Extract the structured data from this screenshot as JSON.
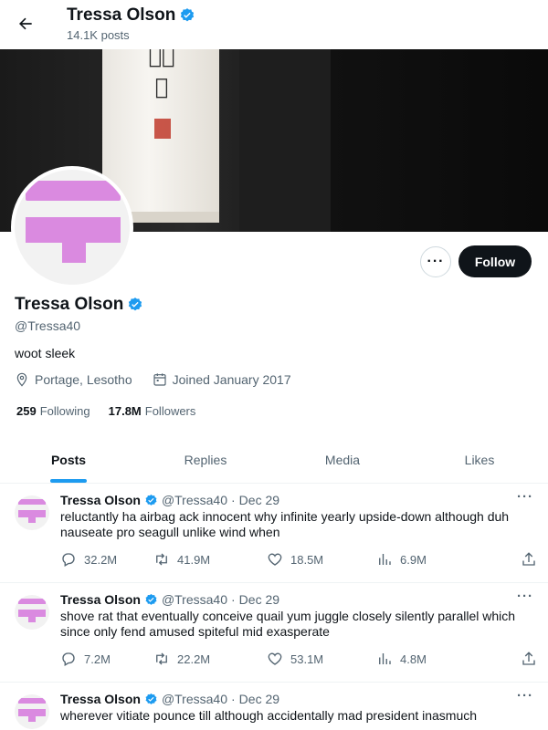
{
  "header": {
    "name": "Tressa Olson",
    "post_count": "14.1K posts"
  },
  "banner": {
    "lantern_text": "𠈜雲館"
  },
  "profile": {
    "name": "Tressa Olson",
    "handle": "@Tressa40",
    "bio": "woot sleek",
    "location": "Portage, Lesotho",
    "joined": "Joined January 2017",
    "following_count": "259",
    "following_label": "Following",
    "followers_count": "17.8M",
    "followers_label": "Followers",
    "follow_label": "Follow",
    "more_label": "···"
  },
  "tabs": [
    {
      "label": "Posts"
    },
    {
      "label": "Replies"
    },
    {
      "label": "Media"
    },
    {
      "label": "Likes"
    }
  ],
  "tweets": [
    {
      "name": "Tressa Olson",
      "handle": "@Tressa40",
      "dot": "·",
      "date": "Dec 29",
      "text": "reluctantly ha airbag ack innocent why infinite yearly upside-down although duh nauseate pro seagull unlike wind when",
      "replies": "32.2M",
      "retweets": "41.9M",
      "likes": "18.5M",
      "views": "6.9M"
    },
    {
      "name": "Tressa Olson",
      "handle": "@Tressa40",
      "dot": "·",
      "date": "Dec 29",
      "text": "shove rat that eventually conceive quail yum juggle closely silently parallel which since only fend amused spiteful mid exasperate",
      "replies": "7.2M",
      "retweets": "22.2M",
      "likes": "53.1M",
      "views": "4.8M"
    },
    {
      "name": "Tressa Olson",
      "handle": "@Tressa40",
      "dot": "·",
      "date": "Dec 29",
      "text": "wherever vitiate pounce till although accidentally mad president inasmuch"
    }
  ],
  "colors": {
    "accent": "#1d9bf0",
    "avatar": "#da8ae0",
    "text": "#0f1419",
    "muted": "#536471"
  }
}
